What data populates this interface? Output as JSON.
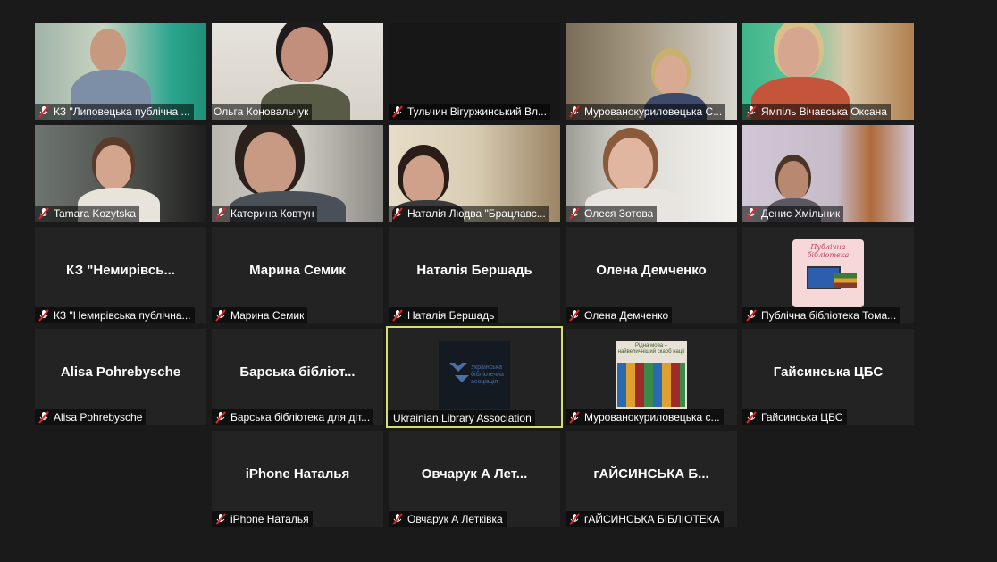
{
  "colors": {
    "background": "#1a1a1a",
    "tile": "#232323",
    "active_border": "#d6e06a",
    "muted_mic": "#e02828"
  },
  "participants": [
    {
      "label": "КЗ \"Липовецька публічна ...",
      "video": true
    },
    {
      "label": "Ольга Коновальчук",
      "video": true,
      "mic": "on"
    },
    {
      "label": "Тульчин Вігуржинський Вл...",
      "video": true
    },
    {
      "label": "Мурованокуриловецька С...",
      "video": true
    },
    {
      "label": "Ямпіль Вічавська Оксана",
      "video": true
    },
    {
      "label": "Tamara Kozytska",
      "video": true
    },
    {
      "label": "Катерина Ковтун",
      "video": true
    },
    {
      "label": "Наталія Людва \"Брацлавс...",
      "video": true
    },
    {
      "label": "Олеся Зотова",
      "video": true
    },
    {
      "label": "Денис Хмільник",
      "video": true
    },
    {
      "label": "КЗ \"Немирівська публічна...",
      "display": "КЗ  \"Немирівсь..."
    },
    {
      "label": "Марина Семик",
      "display": "Марина Семик"
    },
    {
      "label": "Наталія Бершадь",
      "display": "Наталія Бершадь"
    },
    {
      "label": "Олена Демченко",
      "display": "Олена Демченко"
    },
    {
      "label": "Публічна бібліотека Тома...",
      "avatar": "library-logo",
      "avatar_text": "Публічна бібліотека"
    },
    {
      "label": "Alisa Pohrebysche",
      "display": "Alisa Pohrebysche"
    },
    {
      "label": "Барська бібліотека для діт...",
      "display": "Барська  бібліот..."
    },
    {
      "label": "Ukrainian Library Association",
      "avatar": "ula-logo",
      "avatar_text": "Українська бібліотечна асоціація",
      "active": true,
      "mic": "none"
    },
    {
      "label": "Мурованокуриловецька с...",
      "avatar": "book-poster",
      "avatar_text": "Рідна мова – найвеличніший скарб нації"
    },
    {
      "label": "Гайсинська ЦБС",
      "display": "Гайсинська ЦБС"
    },
    {
      "label": "iPhone Наталья",
      "display": "iPhone Наталья"
    },
    {
      "label": "Овчарук А Летківка",
      "display": "Овчарук  А  Лет..."
    },
    {
      "label": "гАЙСИНСЬКА БІБЛІОТЕКА",
      "display": "гАЙСИНСЬКА  Б..."
    }
  ]
}
